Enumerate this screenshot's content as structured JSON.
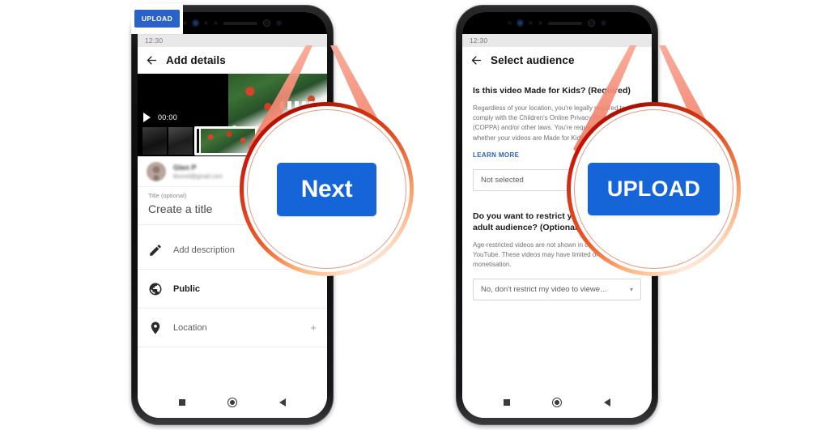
{
  "page": {
    "title": "YouTube mobile upload flow — Add details and Select audience",
    "accent_blue": "#1565d8",
    "header_blue": "#2a62c8",
    "callout_ring_red": "#c81306",
    "callout_ring_orange": "#ef5a2a",
    "link_blue": "#2b5fc2"
  },
  "phones": [
    {
      "id": "add-details",
      "status": {
        "clock": "12:30"
      },
      "appbar": {
        "back_icon": "back-arrow-icon",
        "title": "Add details",
        "action_label": "Next"
      },
      "video": {
        "play_icon": "play-icon",
        "timecode": "00:00",
        "scrubber": "video-scrubber",
        "filmstrip": "video-filmstrip"
      },
      "account": {
        "avatar": "user-avatar",
        "name": "Glen P",
        "email": "blurred@gmail.com"
      },
      "title_field": {
        "label": "Title (optional)",
        "value": "Create a title"
      },
      "list": [
        {
          "icon": "pencil-icon",
          "label": "Add description",
          "trailing": "›",
          "trailing_icon": "chevron-right-icon",
          "emphasis": false
        },
        {
          "icon": "globe-icon",
          "label": "Public",
          "trailing": "",
          "trailing_icon": "",
          "emphasis": true
        },
        {
          "icon": "location-icon",
          "label": "Location",
          "trailing": "+",
          "trailing_icon": "plus-icon",
          "emphasis": false
        }
      ],
      "navbar": {
        "recents": "recents-square-icon",
        "home": "home-circle-icon",
        "back": "back-triangle-icon"
      }
    },
    {
      "id": "select-audience",
      "status": {
        "clock": "12:30"
      },
      "appbar": {
        "back_icon": "back-arrow-icon",
        "title": "Select audience",
        "action_label": "UPLOAD"
      },
      "kids": {
        "question": "Is this video Made for Kids? (Required)",
        "body": "Regardless of your location, you're legally required to comply with the Children's Online Privacy Protection Act (COPPA) and/or other laws. You're required to tell us whether your videos are Made for Kids.",
        "learn_more": "LEARN MORE",
        "select_value": "Not selected",
        "caret_icon": "chevron-down-icon"
      },
      "restrict": {
        "question": "Do you want to restrict your video to an adult audience? (Optional)",
        "body": "Age-restricted videos are not shown in certain areas of YouTube. These videos may have limited or no ads monetisation.",
        "select_value": "No, don't restrict my video to viewe…",
        "caret_icon": "chevron-down-icon"
      },
      "navbar": {
        "recents": "recents-square-icon",
        "home": "home-circle-icon",
        "back": "back-triangle-icon"
      }
    }
  ],
  "callouts": [
    {
      "id": "next-callout",
      "label": "Next"
    },
    {
      "id": "upload-callout",
      "label": "UPLOAD"
    }
  ]
}
